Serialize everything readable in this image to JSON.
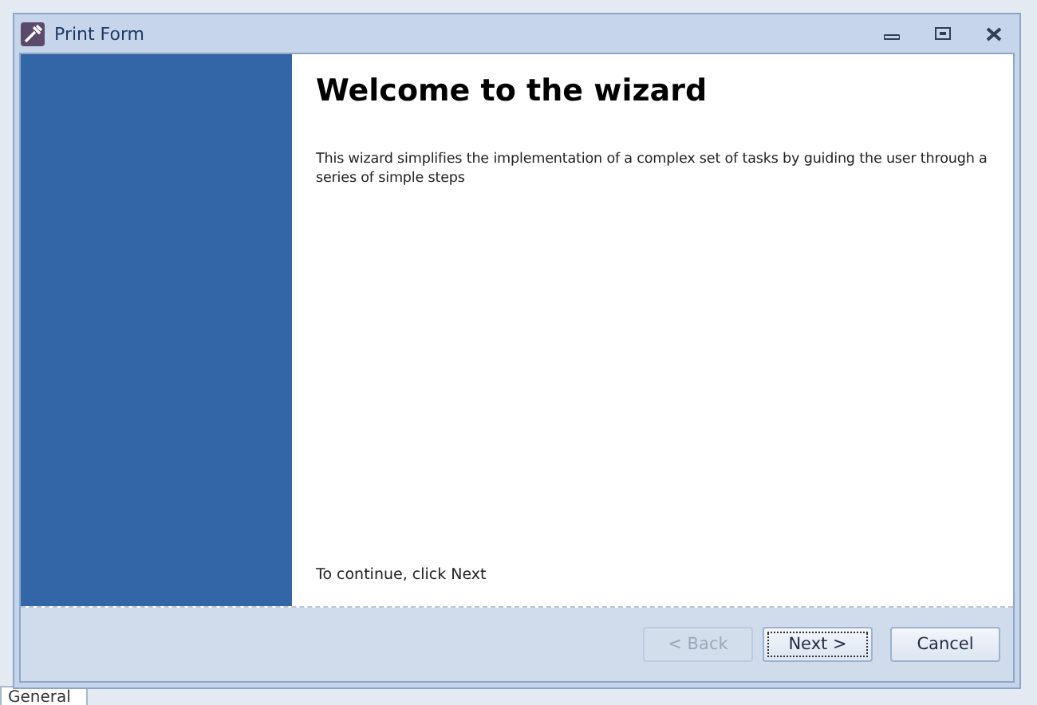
{
  "background_tab": {
    "label": "General"
  },
  "window": {
    "title": "Print Form"
  },
  "page": {
    "heading": "Welcome to the wizard",
    "description": "This wizard simplifies the implementation of a complex set of tasks by guiding the user through a series of simple steps",
    "hint": "To continue, click Next"
  },
  "buttons": [
    {
      "label": "< Back",
      "disabled": true,
      "focused": false
    },
    {
      "label": "Next >",
      "disabled": false,
      "focused": true
    },
    {
      "label": "Cancel",
      "disabled": false,
      "focused": false
    }
  ]
}
